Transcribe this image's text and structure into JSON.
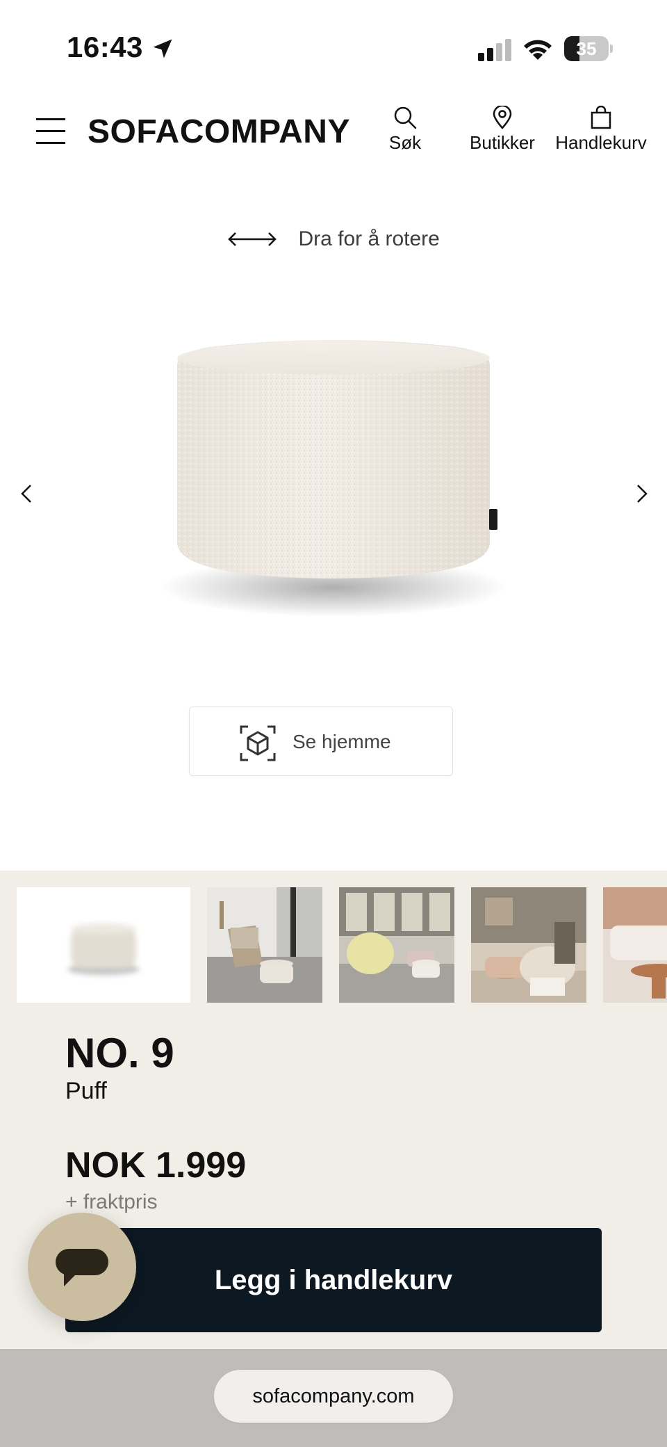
{
  "status_bar": {
    "time": "16:43",
    "battery_level": "35",
    "icons": [
      "location-arrow-icon",
      "cellular-signal-icon",
      "wifi-icon",
      "battery-icon"
    ]
  },
  "header": {
    "logo": "SOFACOMPANY",
    "nav": {
      "search_label": "Søk",
      "stores_label": "Butikker",
      "cart_label": "Handlekurv"
    },
    "icons": [
      "hamburger-menu-icon",
      "search-icon",
      "location-pin-icon",
      "shopping-bag-icon"
    ]
  },
  "viewer": {
    "rotate_hint": "Dra for å rotere",
    "ar_button_label": "Se hjemme",
    "icons": [
      "rotate-arrows-icon",
      "chevron-left-icon",
      "chevron-right-icon",
      "ar-cube-icon"
    ]
  },
  "gallery": {
    "thumbnail_count": 5,
    "selected_index": 1
  },
  "product": {
    "name": "NO. 9",
    "type": "Puff",
    "price": "NOK 1.999",
    "shipping_note": "+ fraktpris",
    "add_to_cart_label": "Legg i handlekurv"
  },
  "chat": {
    "icon": "chat-bubble-icon"
  },
  "browser": {
    "url": "sofacompany.com"
  },
  "colors": {
    "accent_dark": "#0c1822",
    "beige_bg": "#f1eee8",
    "chat_button": "#cbbd9f",
    "muted_text": "#7a7a7a"
  }
}
